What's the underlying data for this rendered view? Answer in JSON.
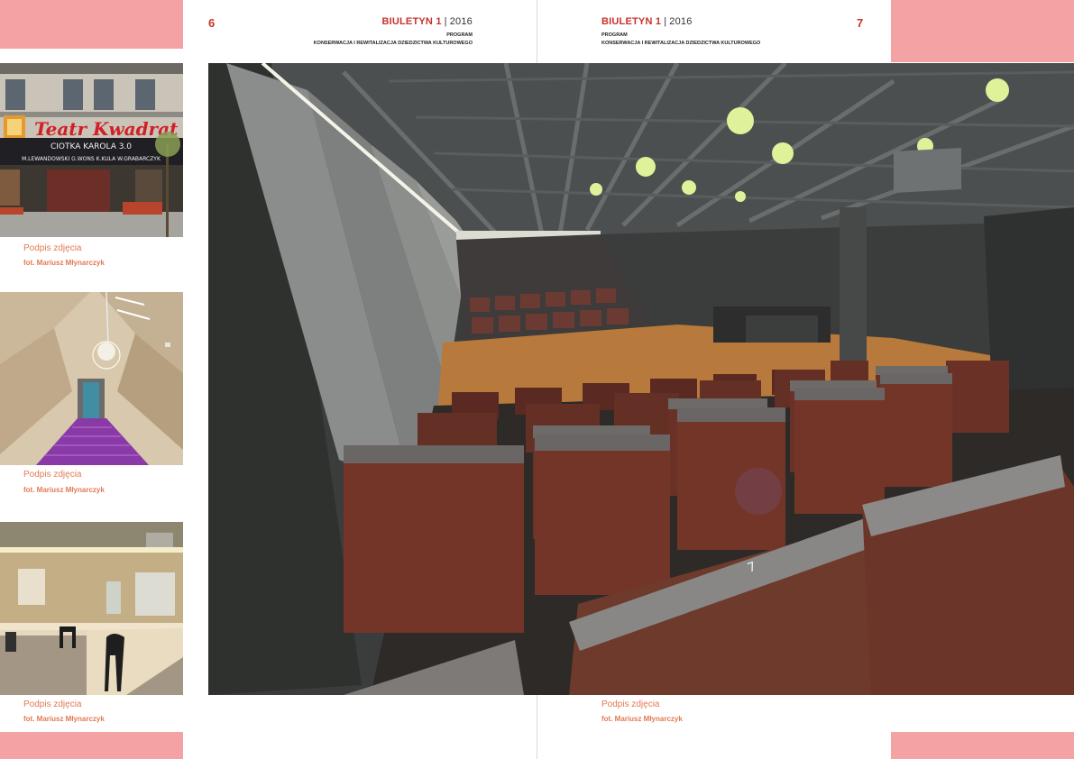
{
  "left_page": {
    "number": "6",
    "brand": "BIULETYN 1",
    "separator": "|",
    "year": "2016",
    "program": "PROGRAM",
    "program_sub": "KONSERWACJA I REWITALIZACJA DZIEDZICTWA KULTUROWEGO"
  },
  "right_page": {
    "number": "7",
    "brand": "BIULETYN 1",
    "separator": "|",
    "year": "2016",
    "program": "PROGRAM",
    "program_sub": "KONSERWACJA I REWITALIZACJA DZIEDZICTWA KULTUROWEGO"
  },
  "photos": {
    "theatre_facade": {
      "sign": "Teatr Kwadrat",
      "marquee_title": "CIOTKA KAROLA 3.0",
      "marquee_cast": "M.LEWANDOWSKI G.WONS K.KULA W.GRABARCZYK",
      "caption": "Podpis zdjęcia",
      "credit": "fot. Mariusz Młynarczyk"
    },
    "staircase": {
      "caption": "Podpis zdjęcia",
      "credit": "fot. Mariusz Młynarczyk"
    },
    "dressing_room": {
      "caption": "Podpis zdjęcia",
      "credit": "fot. Mariusz Młynarczyk"
    },
    "auditorium": {
      "seat_number": "7",
      "caption": "Podpis zdjęcia",
      "credit": "fot. Mariusz Młynarczyk"
    }
  },
  "colors": {
    "accent_red": "#c8322d",
    "caption_orange": "#e07a54",
    "pink_band": "#f4a3a4"
  }
}
